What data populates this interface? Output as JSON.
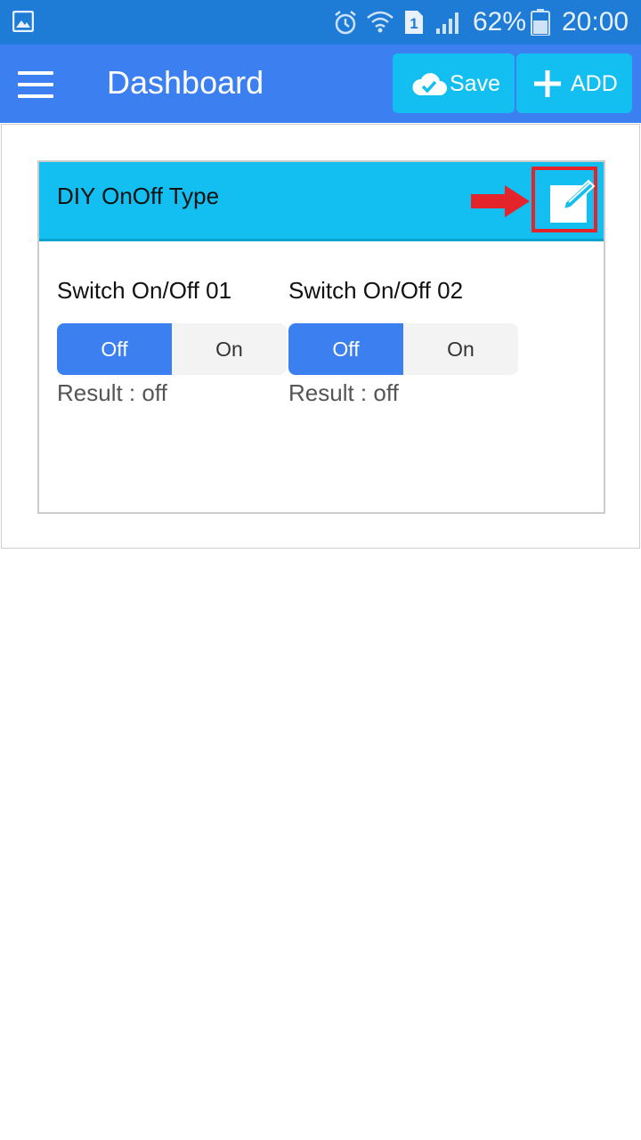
{
  "status_bar": {
    "battery_percent": "62%",
    "time": "20:00",
    "icons": [
      "gallery-icon",
      "alarm-icon",
      "wifi-icon",
      "sim-1-icon",
      "signal-icon",
      "battery-icon"
    ]
  },
  "app_bar": {
    "title": "Dashboard",
    "save_label": "Save",
    "add_label": "ADD",
    "menu_icon": "hamburger-menu-icon",
    "save_icon": "cloud-check-icon",
    "add_icon": "plus-icon"
  },
  "widget": {
    "title": "DIY OnOff Type",
    "edit_icon": "edit-icon",
    "annotation": {
      "arrow_color": "#e3242b",
      "highlight_color": "#e3242b"
    },
    "switches": [
      {
        "label": "Switch On/Off 01",
        "options": [
          "Off",
          "On"
        ],
        "selected": "Off",
        "result": "Result : off"
      },
      {
        "label": "Switch On/Off 02",
        "options": [
          "Off",
          "On"
        ],
        "selected": "Off",
        "result": "Result : off"
      }
    ]
  },
  "colors": {
    "status_bar": "#1e7bd6",
    "app_bar": "#3b7ff0",
    "accent_cyan": "#12bff0",
    "selected_segment": "#3b7ff0"
  }
}
